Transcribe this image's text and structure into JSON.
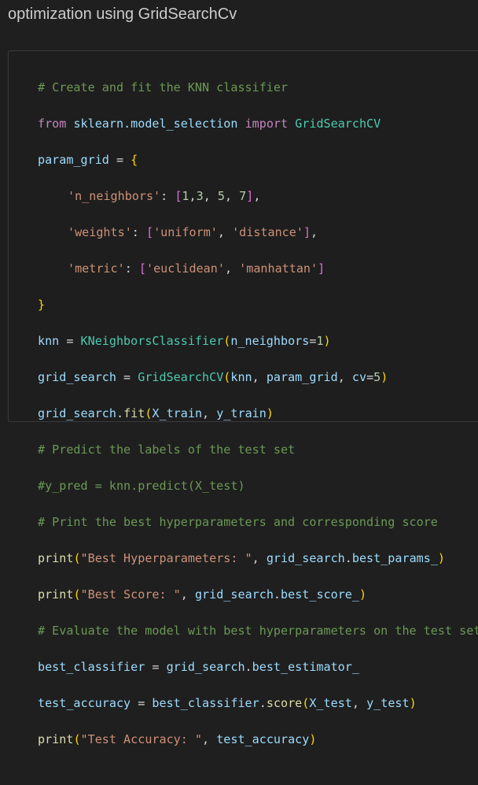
{
  "heading": "optimization using GridSearchCv",
  "code": {
    "l1_comment": "# Create and fit the KNN classifier",
    "l2_from": "from",
    "l2_module": "sklearn.model_selection",
    "l2_import": "import",
    "l2_name": "GridSearchCV",
    "l3_var": "param_grid",
    "l3_eq": " = ",
    "l3_brace": "{",
    "l4_key": "'n_neighbors'",
    "l4_colon": ": ",
    "l4_lb": "[",
    "l4_n1": "1",
    "l4_n2": "3",
    "l4_n3": "5",
    "l4_n4": "7",
    "l4_rb": "]",
    "l5_key": "'weights'",
    "l5_v1": "'uniform'",
    "l5_v2": "'distance'",
    "l6_key": "'metric'",
    "l6_v1": "'euclidean'",
    "l6_v2": "'manhattan'",
    "l7_brace": "}",
    "l8_var": "knn",
    "l8_cls": "KNeighborsClassifier",
    "l8_arg": "n_neighbors",
    "l8_num": "1",
    "l9_var": "grid_search",
    "l9_cls": "GridSearchCV",
    "l9_a1": "knn",
    "l9_a2": "param_grid",
    "l9_a3": "cv",
    "l9_num": "5",
    "l10_obj": "grid_search",
    "l10_fn": "fit",
    "l10_a1": "X_train",
    "l10_a2": "y_train",
    "l11_comment": "# Predict the labels of the test set",
    "l12_comment": "#y_pred = knn.predict(X_test)",
    "l13_comment": "# Print the best hyperparameters and corresponding score",
    "l14_fn": "print",
    "l14_str": "\"Best Hyperparameters: \"",
    "l14_obj": "grid_search",
    "l14_attr": "best_params_",
    "l15_fn": "print",
    "l15_str": "\"Best Score: \"",
    "l15_obj": "grid_search",
    "l15_attr": "best_score_",
    "l16_comment": "# Evaluate the model with best hyperparameters on the test set",
    "l17_var": "best_classifier",
    "l17_obj": "grid_search",
    "l17_attr": "best_estimator_",
    "l18_var": "test_accuracy",
    "l18_obj": "best_classifier",
    "l18_fn": "score",
    "l18_a1": "X_test",
    "l18_a2": "y_test",
    "l19_fn": "print",
    "l19_str": "\"Test Accuracy: \"",
    "l19_a1": "test_accuracy"
  }
}
